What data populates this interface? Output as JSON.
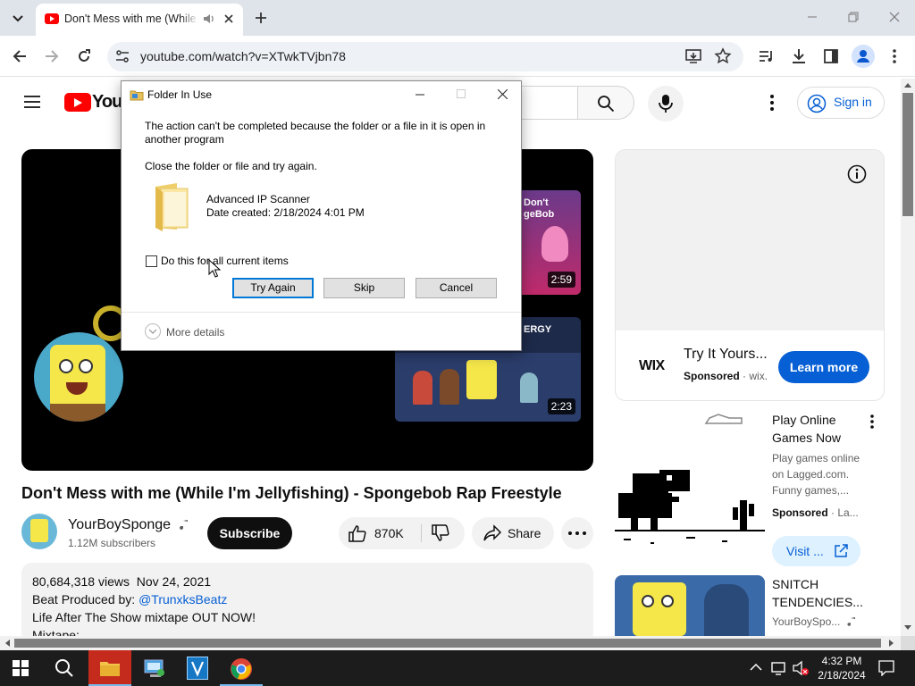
{
  "browser": {
    "tab_title": "Don't Mess with me (While I'm Jellyfishing) - Spongebob Rap Freestyle - YouTube",
    "url": "youtube.com/watch?v=XTwkTVjbn78"
  },
  "youtube": {
    "logo_text": "YouT",
    "signin_label": "Sign in",
    "video_title": "Don't Mess with me (While I'm Jellyfishing) - Spongebob Rap Freestyle",
    "channel_name": "YourBoySponge",
    "subscribers": "1.12M subscribers",
    "subscribe_label": "Subscribe",
    "likes": "870K",
    "share_label": "Share",
    "description": {
      "views": "80,684,318 views",
      "date": "Nov 24, 2021",
      "line1_prefix": "Beat Produced by: ",
      "line1_link": "@TrunxksBeatz",
      "line2": "Life After The Show mixtape OUT NOW!",
      "line3": "Mixtape:"
    },
    "endscreen": [
      {
        "text": "Don't\ngeBob",
        "duration": "2:59"
      },
      {
        "text": "ERGY",
        "duration": "2:23"
      }
    ]
  },
  "sidebar": {
    "ad": {
      "brand": "WIX",
      "title": "Try It Yours...",
      "sponsored": "Sponsored",
      "domain": "wix.",
      "cta": "Learn more"
    },
    "game_ad": {
      "title": "Play Online Games Now",
      "desc": "Play games online on Lagged.com. Funny games,...",
      "sponsored": "Sponsored",
      "domain": "La...",
      "cta": "Visit ..."
    },
    "rec_video": {
      "title": "SNITCH TENDENCIES...",
      "channel": "YourBoySpo..."
    }
  },
  "dialog": {
    "title": "Folder In Use",
    "message": "The action can't be completed because the folder or a file in it is open in another program",
    "instruction": "Close the folder or file and try again.",
    "file_name": "Advanced IP Scanner",
    "file_date": "Date created: 2/18/2024 4:01 PM",
    "checkbox_label": "Do this for all current items",
    "checkbox_checked": false,
    "buttons": {
      "try_again": "Try Again",
      "skip": "Skip",
      "cancel": "Cancel"
    },
    "more_details": "More details"
  },
  "taskbar": {
    "time": "4:32 PM",
    "date": "2/18/2024"
  },
  "colors": {
    "yt_red": "#ff0000",
    "link_blue": "#065fd4",
    "taskbar": "#1c1c1c"
  }
}
